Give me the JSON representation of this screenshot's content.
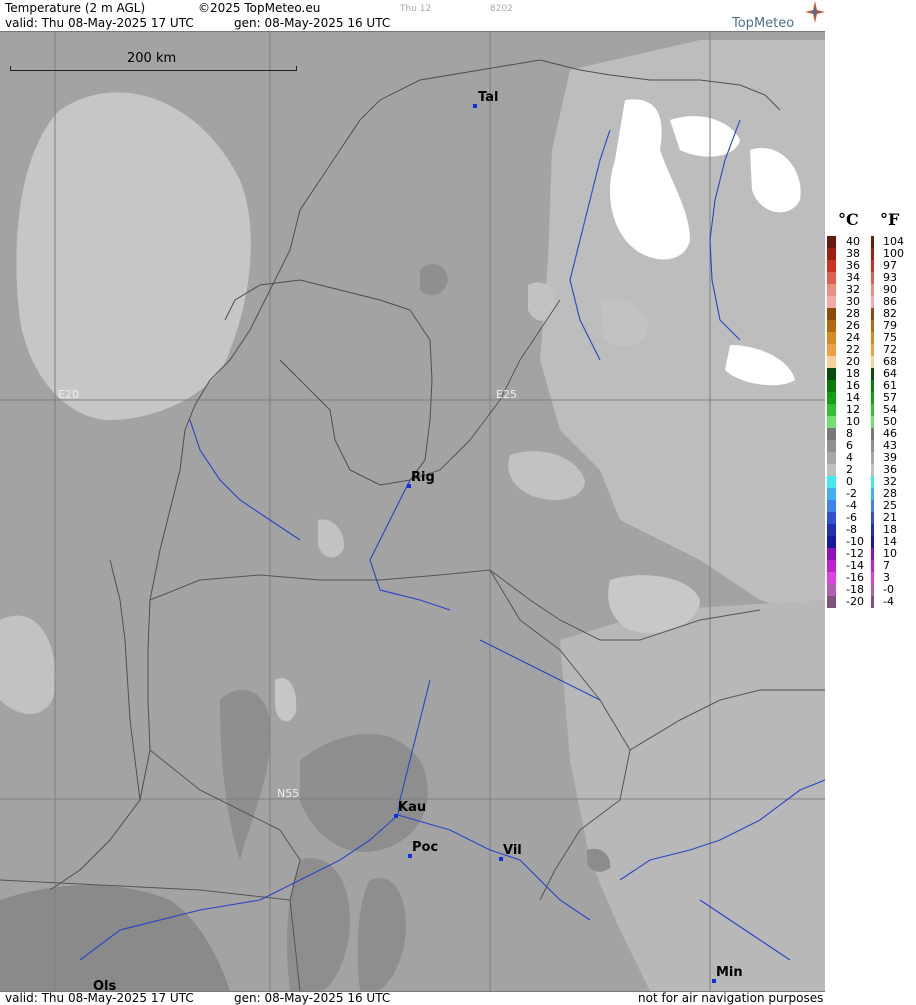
{
  "header": {
    "title": "Temperature (2 m AGL)",
    "copyright": "©2025 TopMeteo.eu",
    "day_hint": "Thu 12",
    "code_hint": "8202",
    "valid": "valid:  Thu  08-May-2025  17 UTC",
    "generated": "gen: 08-May-2025 16 UTC",
    "logo": "TopMeteo"
  },
  "scale": {
    "label": "200 km"
  },
  "grid_labels": [
    "E20",
    "E25",
    "N55"
  ],
  "cities": [
    "Tal",
    "Rig",
    "Kau",
    "Poc",
    "Vil",
    "Min",
    "Ols"
  ],
  "legend": {
    "celsius_unit": "°C",
    "fahrenheit_unit": "°F",
    "celsius": [
      "40",
      "38",
      "36",
      "34",
      "32",
      "30",
      "28",
      "26",
      "24",
      "22",
      "20",
      "18",
      "16",
      "14",
      "12",
      "10",
      "8",
      "6",
      "4",
      "2",
      "0",
      "-2",
      "-4",
      "-6",
      "-8",
      "-10",
      "-12",
      "-14",
      "-16",
      "-18",
      "-20"
    ],
    "fahrenheit": [
      "104",
      "100",
      "97",
      "93",
      "90",
      "86",
      "82",
      "79",
      "75",
      "72",
      "68",
      "64",
      "61",
      "57",
      "54",
      "50",
      "46",
      "43",
      "39",
      "36",
      "32",
      "28",
      "25",
      "21",
      "18",
      "14",
      "10",
      "7",
      "3",
      "-0",
      "-4"
    ],
    "colors": [
      "#6a1a0a",
      "#a02010",
      "#d03020",
      "#e06050",
      "#ec8e82",
      "#f4aaa6",
      "#8a4a08",
      "#b06a10",
      "#d88a20",
      "#f0a040",
      "#f8d09a",
      "#0a4a0a",
      "#0a7a0a",
      "#10a010",
      "#30c030",
      "#70e070",
      "#787878",
      "#909090",
      "#a8a8a8",
      "#c0c0c0",
      "#40e8f0",
      "#40b0f0",
      "#4080f0",
      "#3050d8",
      "#2030b0",
      "#1818a0",
      "#9010c0",
      "#c020d0",
      "#e040e0",
      "#b060b0",
      "#805080"
    ]
  },
  "footer": {
    "valid": "valid:  Thu  08-May-2025  17 UTC",
    "generated": "gen: 08-May-2025 16 UTC",
    "disclaimer": "not for air navigation purposes"
  }
}
